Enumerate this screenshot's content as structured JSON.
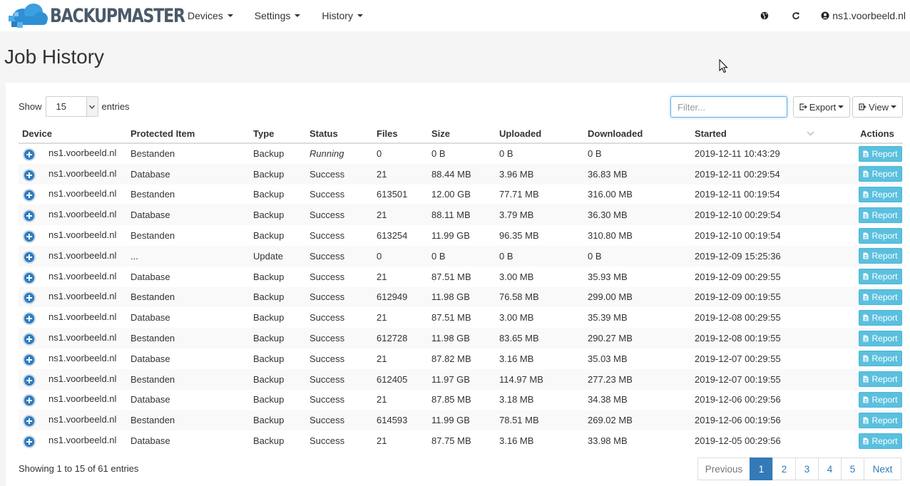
{
  "brand": {
    "name": "BACKUPMASTER"
  },
  "nav": {
    "menus": [
      {
        "label": "Devices"
      },
      {
        "label": "Settings"
      },
      {
        "label": "History"
      }
    ],
    "user": "ns1.voorbeeld.nl"
  },
  "page": {
    "title": "Job History"
  },
  "controls": {
    "show_label": "Show",
    "page_size": "15",
    "entries_label": "entries",
    "filter_placeholder": "Filter...",
    "export_label": "Export",
    "view_label": "View"
  },
  "table": {
    "columns": [
      "Device",
      "Protected Item",
      "Type",
      "Status",
      "Files",
      "Size",
      "Uploaded",
      "Downloaded",
      "Started",
      "Actions"
    ],
    "report_label": "Report",
    "rows": [
      {
        "device": "ns1.voorbeeld.nl",
        "item": "Bestanden",
        "type": "Backup",
        "status": "Running",
        "files": "0",
        "size": "0 B",
        "uploaded": "0 B",
        "downloaded": "0 B",
        "started": "2019-12-11 10:43:29"
      },
      {
        "device": "ns1.voorbeeld.nl",
        "item": "Database",
        "type": "Backup",
        "status": "Success",
        "files": "21",
        "size": "88.44 MB",
        "uploaded": "3.96 MB",
        "downloaded": "36.83 MB",
        "started": "2019-12-11 00:29:54"
      },
      {
        "device": "ns1.voorbeeld.nl",
        "item": "Bestanden",
        "type": "Backup",
        "status": "Success",
        "files": "613501",
        "size": "12.00 GB",
        "uploaded": "77.71 MB",
        "downloaded": "316.00 MB",
        "started": "2019-12-11 00:19:54"
      },
      {
        "device": "ns1.voorbeeld.nl",
        "item": "Database",
        "type": "Backup",
        "status": "Success",
        "files": "21",
        "size": "88.11 MB",
        "uploaded": "3.79 MB",
        "downloaded": "36.30 MB",
        "started": "2019-12-10 00:29:54"
      },
      {
        "device": "ns1.voorbeeld.nl",
        "item": "Bestanden",
        "type": "Backup",
        "status": "Success",
        "files": "613254",
        "size": "11.99 GB",
        "uploaded": "96.35 MB",
        "downloaded": "310.80 MB",
        "started": "2019-12-10 00:19:54"
      },
      {
        "device": "ns1.voorbeeld.nl",
        "item": "...",
        "type": "Update",
        "status": "Success",
        "files": "0",
        "size": "0 B",
        "uploaded": "0 B",
        "downloaded": "0 B",
        "started": "2019-12-09 15:25:36"
      },
      {
        "device": "ns1.voorbeeld.nl",
        "item": "Database",
        "type": "Backup",
        "status": "Success",
        "files": "21",
        "size": "87.51 MB",
        "uploaded": "3.00 MB",
        "downloaded": "35.93 MB",
        "started": "2019-12-09 00:29:55"
      },
      {
        "device": "ns1.voorbeeld.nl",
        "item": "Bestanden",
        "type": "Backup",
        "status": "Success",
        "files": "612949",
        "size": "11.98 GB",
        "uploaded": "76.58 MB",
        "downloaded": "299.00 MB",
        "started": "2019-12-09 00:19:55"
      },
      {
        "device": "ns1.voorbeeld.nl",
        "item": "Database",
        "type": "Backup",
        "status": "Success",
        "files": "21",
        "size": "87.51 MB",
        "uploaded": "3.00 MB",
        "downloaded": "35.39 MB",
        "started": "2019-12-08 00:29:55"
      },
      {
        "device": "ns1.voorbeeld.nl",
        "item": "Bestanden",
        "type": "Backup",
        "status": "Success",
        "files": "612728",
        "size": "11.98 GB",
        "uploaded": "83.65 MB",
        "downloaded": "290.27 MB",
        "started": "2019-12-08 00:19:55"
      },
      {
        "device": "ns1.voorbeeld.nl",
        "item": "Database",
        "type": "Backup",
        "status": "Success",
        "files": "21",
        "size": "87.82 MB",
        "uploaded": "3.16 MB",
        "downloaded": "35.03 MB",
        "started": "2019-12-07 00:29:55"
      },
      {
        "device": "ns1.voorbeeld.nl",
        "item": "Bestanden",
        "type": "Backup",
        "status": "Success",
        "files": "612405",
        "size": "11.97 GB",
        "uploaded": "114.97 MB",
        "downloaded": "277.23 MB",
        "started": "2019-12-07 00:19:55"
      },
      {
        "device": "ns1.voorbeeld.nl",
        "item": "Database",
        "type": "Backup",
        "status": "Success",
        "files": "21",
        "size": "87.85 MB",
        "uploaded": "3.18 MB",
        "downloaded": "34.38 MB",
        "started": "2019-12-06 00:29:56"
      },
      {
        "device": "ns1.voorbeeld.nl",
        "item": "Bestanden",
        "type": "Backup",
        "status": "Success",
        "files": "614593",
        "size": "11.99 GB",
        "uploaded": "78.51 MB",
        "downloaded": "269.02 MB",
        "started": "2019-12-06 00:19:56"
      },
      {
        "device": "ns1.voorbeeld.nl",
        "item": "Database",
        "type": "Backup",
        "status": "Success",
        "files": "21",
        "size": "87.75 MB",
        "uploaded": "3.16 MB",
        "downloaded": "33.98 MB",
        "started": "2019-12-05 00:29:56"
      }
    ]
  },
  "footer": {
    "info": "Showing 1 to 15 of 61 entries",
    "pagination": [
      "Previous",
      "1",
      "2",
      "3",
      "4",
      "5",
      "Next"
    ],
    "active_page": "1"
  },
  "colors": {
    "accent": "#337ab7",
    "success": "#3c8a18",
    "report_button": "#5bc0de",
    "expand_button": "#2b7cc1"
  },
  "icons": [
    "cloud-logo-icon",
    "globe-icon",
    "refresh-icon",
    "user-icon",
    "export-icon",
    "view-icon",
    "expand-icon",
    "file-icon",
    "sort-chevron-icon",
    "mouse-cursor-icon"
  ]
}
